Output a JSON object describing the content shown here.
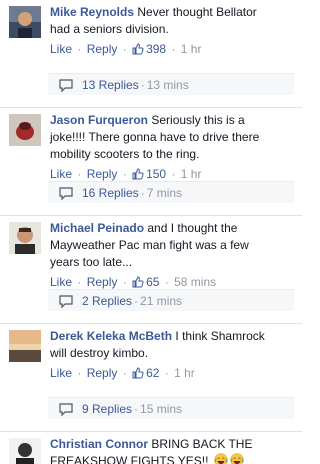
{
  "comments": [
    {
      "author": "Mike Reynolds",
      "text_line1": "Never thought Bellator",
      "text_line2": "had a seniors division.",
      "text_line3": "",
      "like_label": "Like",
      "reply_label": "Reply",
      "likes": "398",
      "time": "1 hr",
      "replies_label": "13 Replies",
      "replies_time": "13 mins"
    },
    {
      "author": "Jason Furqueron",
      "text_line1": "Seriously this is a",
      "text_line2": "joke!!!! There gonna have to drive there",
      "text_line3": "mobility scooters to the ring.",
      "like_label": "Like",
      "reply_label": "Reply",
      "likes": "150",
      "time": "1 hr",
      "replies_label": "16 Replies",
      "replies_time": "7 mins"
    },
    {
      "author": "Michael Peinado",
      "text_line1": "and I thought the",
      "text_line2": "Mayweather Pac man fight was a few",
      "text_line3": "years too late...",
      "like_label": "Like",
      "reply_label": "Reply",
      "likes": "65",
      "time": "58 mins",
      "replies_label": "2 Replies",
      "replies_time": "21 mins"
    },
    {
      "author": "Derek Keleka McBeth",
      "text_line1": "I think Shamrock",
      "text_line2": "will destroy kimbo.",
      "text_line3": "",
      "like_label": "Like",
      "reply_label": "Reply",
      "likes": "62",
      "time": "1 hr",
      "replies_label": "9 Replies",
      "replies_time": "15 mins"
    },
    {
      "author": "Christian Connor",
      "text_line1": "BRING BACK THE",
      "text_line2": "FREAKSHOW FIGHTS YES!!",
      "text_line3": ""
    }
  ],
  "separator": "·",
  "icons": {
    "like": "thumbs-up-icon",
    "reply": "reply-bubble-icon",
    "emoji": "crying-laughing-emoji-icon"
  },
  "colors": {
    "link": "#3b5998",
    "meta": "#9197a3",
    "text": "#141823",
    "reply_bar": "#f6f7f9"
  }
}
